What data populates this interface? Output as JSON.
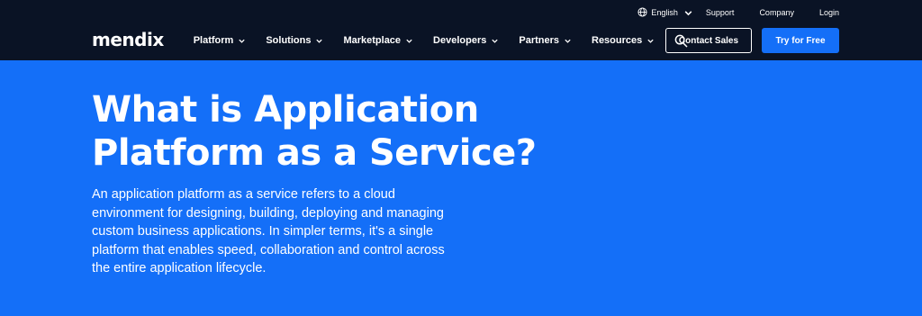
{
  "utility": {
    "language": "English",
    "links": [
      "Support",
      "Company",
      "Login"
    ]
  },
  "nav": {
    "logo": "mendix",
    "items": [
      "Platform",
      "Solutions",
      "Marketplace",
      "Developers",
      "Partners",
      "Resources"
    ],
    "contact_label": "Contact Sales",
    "try_label": "Try for Free"
  },
  "hero": {
    "title_line1": "What is Application",
    "title_line2": "Platform as a Service?",
    "description": "An application platform as a service refers to a cloud environment for designing, building, deploying and managing custom business applications. In simpler terms, it's a single platform that enables speed, collaboration and control across the entire application lifecycle."
  },
  "colors": {
    "header_bg": "#0a1325",
    "hero_bg": "#146ff8",
    "primary_button": "#146ff8"
  },
  "icons": [
    "globe-icon",
    "chevron-down-icon",
    "search-icon"
  ]
}
